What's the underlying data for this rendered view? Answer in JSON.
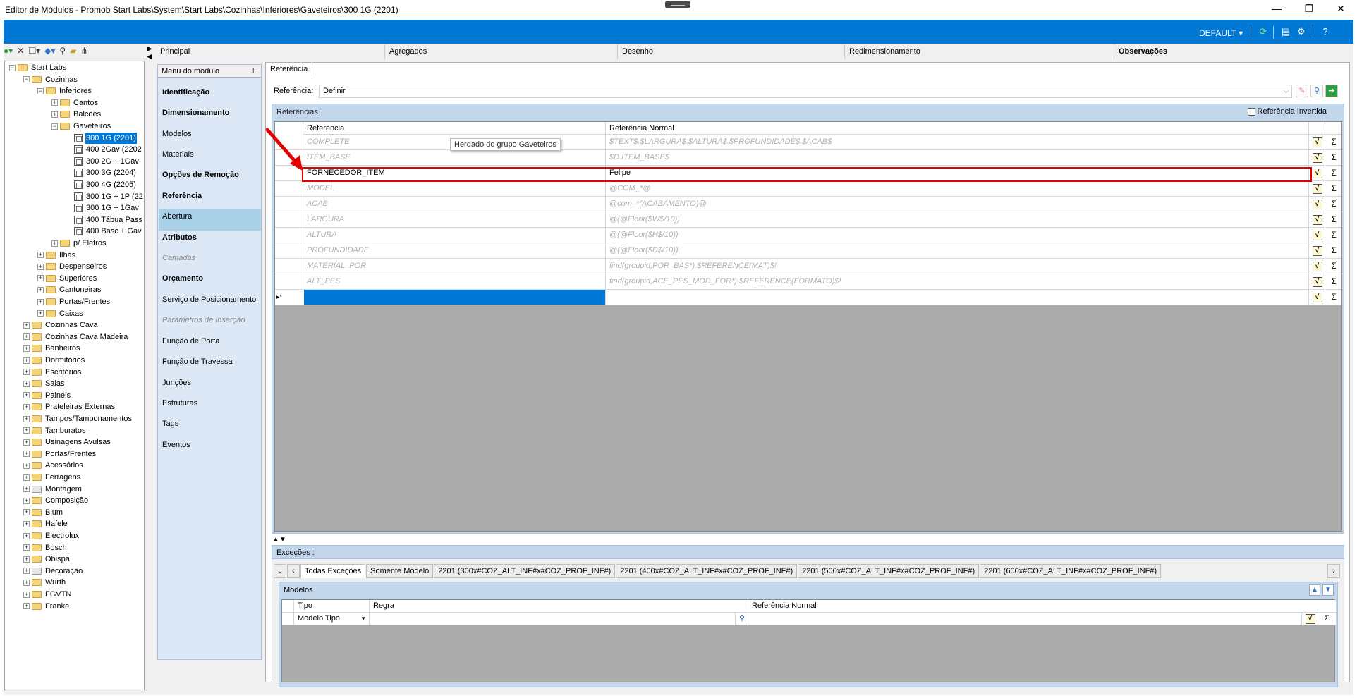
{
  "window": {
    "title": "Editor de Módulos - Promob Start Labs\\System\\Start Labs\\Cozinhas\\Inferiores\\Gaveteiros\\300 1G (2201)"
  },
  "topbar": {
    "default_label": "DEFAULT",
    "accent": "#0079d6"
  },
  "tree": {
    "root": "Start Labs",
    "cozinhas": "Cozinhas",
    "inferiores": "Inferiores",
    "cantos": "Cantos",
    "balcoes": "Balcões",
    "gaveteiros": "Gaveteiros",
    "modules": [
      "300 1G (2201)",
      "400 2Gav (2202",
      "300 2G + 1Gav",
      "300 3G (2204)",
      "300 4G (2205)",
      "300 1G + 1P (22",
      "300 1G + 1Gav",
      "400 Tábua Pass",
      "400 Basc + Gav"
    ],
    "eletros": "p/ Eletros",
    "cozinhas_children": [
      "Ilhas",
      "Despenseiros",
      "Superiores",
      "Cantoneiras",
      "Portas/Frentes",
      "Caixas"
    ],
    "top_level": [
      "Cozinhas Cava",
      "Cozinhas Cava Madeira",
      "Banheiros",
      "Dormitórios",
      "Escritórios",
      "Salas",
      "Painéis",
      "Prateleiras Externas",
      "Tampos/Tamponamentos",
      "Tamburatos",
      "Usinagens Avulsas",
      "Portas/Frentes",
      "Acessórios",
      "Ferragens",
      "Montagem",
      "Composição",
      "Blum",
      "Hafele",
      "Electrolux",
      "Bosch",
      "Obispa",
      "Decoração",
      "Wurth",
      "FGVTN",
      "Franke"
    ]
  },
  "main_tabs": [
    "Principal",
    "Agregados",
    "Desenho",
    "Redimensionamento",
    "Observações"
  ],
  "left_menu": {
    "header": "Menu do módulo",
    "items": [
      {
        "label": "Identificação",
        "style": "bold"
      },
      {
        "label": "Dimensionamento",
        "style": "bold"
      },
      {
        "label": "Modelos",
        "style": "normal"
      },
      {
        "label": "Materiais",
        "style": "normal"
      },
      {
        "label": "Opções de Remoção",
        "style": "bold"
      },
      {
        "label": "Referência",
        "style": "bold"
      },
      {
        "label": "Abertura",
        "style": "normal"
      },
      {
        "label": "Atributos",
        "style": "bold"
      },
      {
        "label": "Camadas",
        "style": "disabled"
      },
      {
        "label": "Orçamento",
        "style": "bold"
      },
      {
        "label": "Serviço de Posicionamento",
        "style": "normal"
      },
      {
        "label": "Parâmetros de Inserção",
        "style": "disabled"
      },
      {
        "label": "Função de Porta",
        "style": "normal"
      },
      {
        "label": "Função de Travessa",
        "style": "normal"
      },
      {
        "label": "Junções",
        "style": "normal"
      },
      {
        "label": "Estruturas",
        "style": "normal"
      },
      {
        "label": "Tags",
        "style": "normal"
      },
      {
        "label": "Eventos",
        "style": "normal"
      }
    ],
    "selected": "Referência"
  },
  "reference": {
    "tab": "Referência",
    "field_label": "Referência:",
    "field_value": "Definir",
    "group_title": "Referências",
    "invert_label": "Referência Invertida",
    "columns": [
      "Referência",
      "Referência Normal"
    ],
    "tooltip": "Herdado do grupo Gaveteiros",
    "new_row_marker": "▸*",
    "rows": [
      {
        "name": "COMPLETE",
        "value": "$TEXT$.$LARGURA$.$ALTURA$.$PROFUNDIDADE$.$ACAB$",
        "inherited": true
      },
      {
        "name": "ITEM_BASE",
        "value": "$D.ITEM_BASE$",
        "inherited": true
      },
      {
        "name": "FORNECEDOR_ITEM",
        "value": "Felipe",
        "inherited": false
      },
      {
        "name": "MODEL",
        "value": "@COM_*@",
        "inherited": true
      },
      {
        "name": "ACAB",
        "value": "@com_*(ACABAMENTO)@",
        "inherited": true
      },
      {
        "name": "LARGURA",
        "value": "@(@Floor($W$/10))",
        "inherited": true
      },
      {
        "name": "ALTURA",
        "value": "@(@Floor($H$/10))",
        "inherited": true
      },
      {
        "name": "PROFUNDIDADE",
        "value": "@(@Floor($D$/10))",
        "inherited": true
      },
      {
        "name": "MATERIAL_POR",
        "value": "find(groupid,POR_BAS*).$REFERENCE(MAT)$!",
        "inherited": true
      },
      {
        "name": "ALT_PES",
        "value": "find(groupid,ACE_PES_MOD_FOR*).$REFERENCE(FORMATO)$!",
        "inherited": true
      }
    ]
  },
  "exceptions": {
    "title": "Exceções :",
    "tabs": [
      "Todas Exceções",
      "Somente Modelo",
      "2201 (300x#COZ_ALT_INF#x#COZ_PROF_INF#)",
      "2201 (400x#COZ_ALT_INF#x#COZ_PROF_INF#)",
      "2201 (500x#COZ_ALT_INF#x#COZ_PROF_INF#)",
      "2201 (600x#COZ_ALT_INF#x#COZ_PROF_INF#)"
    ],
    "models_title": "Modelos",
    "columns": [
      "Tipo",
      "Regra",
      "Referência Normal"
    ],
    "row_tipo": "Modelo Tipo"
  }
}
